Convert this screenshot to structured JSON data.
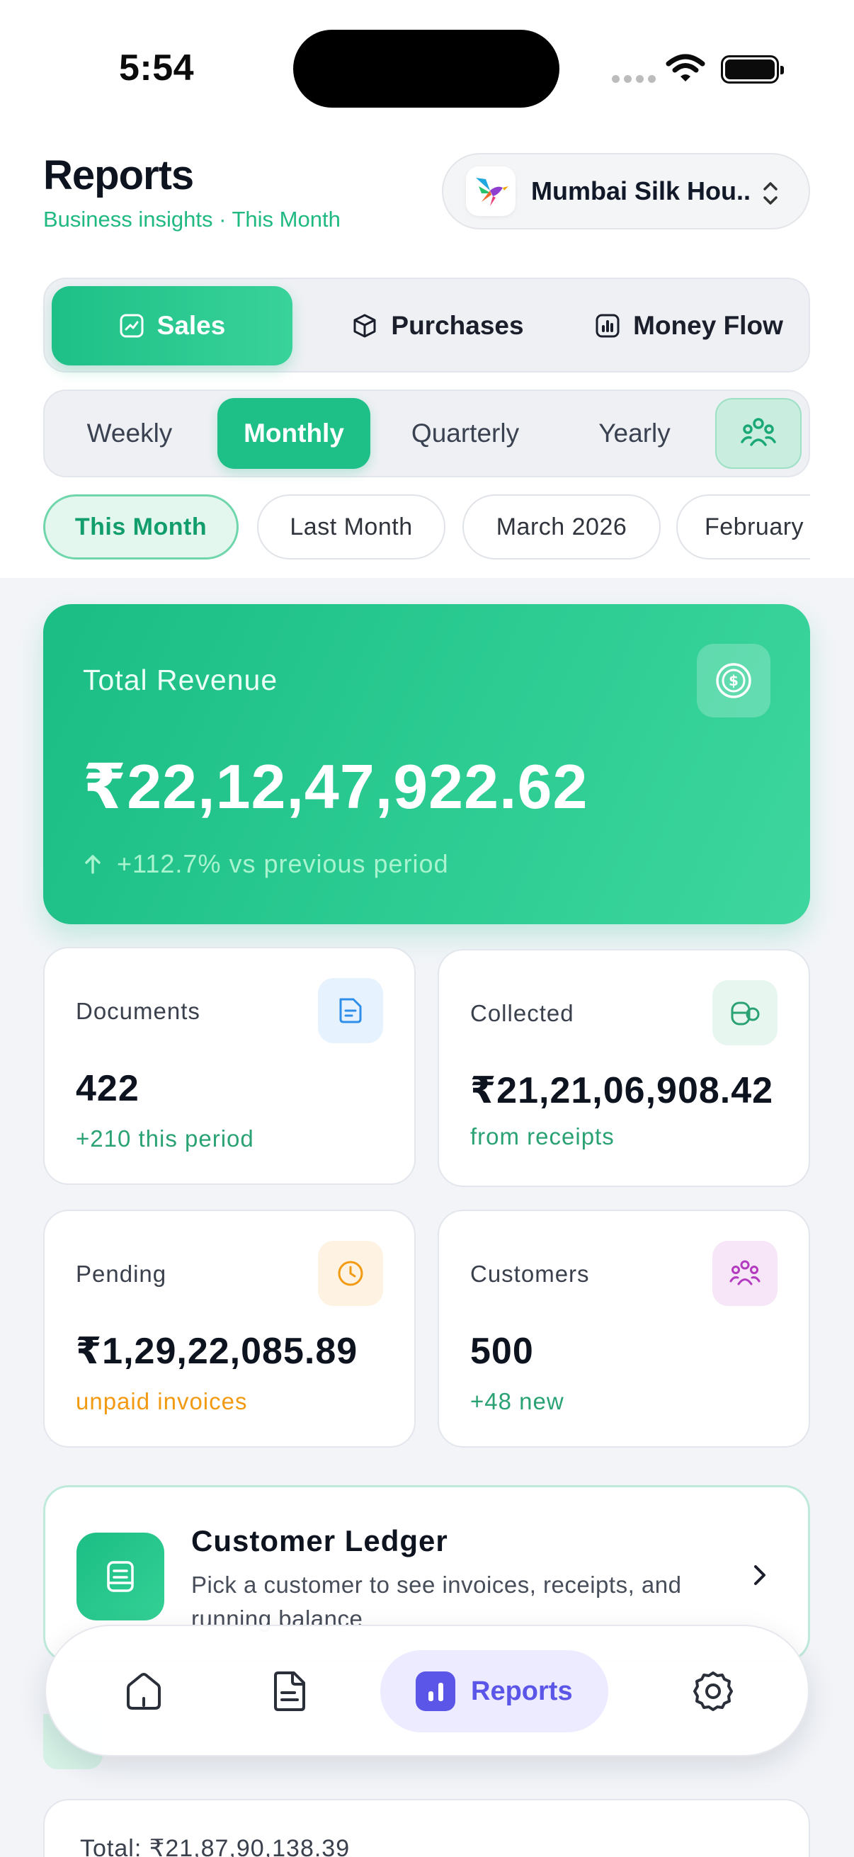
{
  "status_bar": {
    "time": "5:54"
  },
  "header": {
    "title": "Reports",
    "subtitle": "Business insights · This Month",
    "business_name": "Mumbai Silk Hou..."
  },
  "report_types": [
    {
      "label": "Sales",
      "icon": "trend-chart-icon",
      "active": true
    },
    {
      "label": "Purchases",
      "icon": "box-icon",
      "active": false
    },
    {
      "label": "Money Flow",
      "icon": "bar-chart-icon",
      "active": false
    }
  ],
  "periods": [
    {
      "label": "Weekly",
      "active": false
    },
    {
      "label": "Monthly",
      "active": true
    },
    {
      "label": "Quarterly",
      "active": false
    },
    {
      "label": "Yearly",
      "active": false
    }
  ],
  "range_chips": [
    {
      "label": "This Month",
      "active": true
    },
    {
      "label": "Last Month",
      "active": false
    },
    {
      "label": "March 2026",
      "active": false
    },
    {
      "label": "February",
      "active": false
    }
  ],
  "revenue": {
    "label": "Total Revenue",
    "amount": "₹22,12,47,922.62",
    "trend": "+112.7% vs previous period"
  },
  "stats": {
    "documents": {
      "label": "Documents",
      "value": "422",
      "note": "+210 this period"
    },
    "collected": {
      "label": "Collected",
      "value": "₹21,21,06,908.42",
      "note": "from receipts"
    },
    "pending": {
      "label": "Pending",
      "value": "₹1,29,22,085.89",
      "note": "unpaid invoices"
    },
    "customers": {
      "label": "Customers",
      "value": "500",
      "note": "+48 new"
    }
  },
  "ledger": {
    "title": "Customer Ledger",
    "description": "Pick a customer to see invoices, receipts, and running balance"
  },
  "total_line": "Total: ₹21,87,90,138.39",
  "nav": {
    "reports_label": "Reports"
  },
  "colors": {
    "accent_green": "#1ec087",
    "nav_active": "#5b56e8",
    "pending_orange": "#f29a12"
  }
}
